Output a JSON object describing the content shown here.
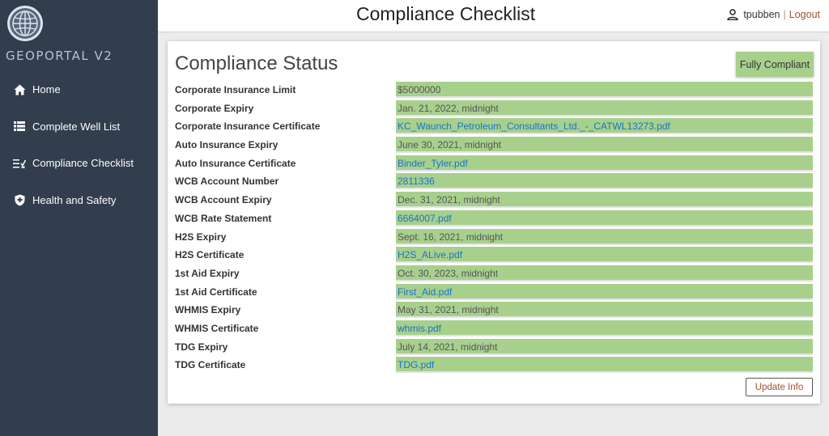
{
  "app": {
    "brand": "GEOPORTAL V2"
  },
  "sidebar": {
    "items": [
      {
        "label": "Home",
        "icon": "home-icon"
      },
      {
        "label": "Complete Well List",
        "icon": "list-icon"
      },
      {
        "label": "Compliance Checklist",
        "icon": "checklist-icon"
      },
      {
        "label": "Health and Safety",
        "icon": "shield-icon"
      }
    ]
  },
  "header": {
    "title": "Compliance Checklist",
    "username": "tpubben",
    "separator": "|",
    "logout_label": "Logout"
  },
  "card": {
    "title": "Compliance Status",
    "status": "Fully Compliant",
    "update_label": "Update Info",
    "rows": [
      {
        "label": "Corporate Insurance Limit",
        "value": "$5000000",
        "link": false
      },
      {
        "label": "Corporate Expiry",
        "value": "Jan. 21, 2022, midnight",
        "link": false
      },
      {
        "label": "Corporate Insurance Certificate",
        "value": "KC_Waunch_Petroleum_Consultants_Ltd._-_CATWL13273.pdf",
        "link": true
      },
      {
        "label": "Auto Insurance Expiry",
        "value": "June 30, 2021, midnight",
        "link": false
      },
      {
        "label": "Auto Insurance Certificate",
        "value": "Binder_Tyler.pdf",
        "link": true
      },
      {
        "label": "WCB Account Number",
        "value": "2811336",
        "link": true
      },
      {
        "label": "WCB Account Expiry",
        "value": "Dec. 31, 2021, midnight",
        "link": false
      },
      {
        "label": "WCB Rate Statement",
        "value": "6664007.pdf",
        "link": true
      },
      {
        "label": "H2S Expiry",
        "value": "Sept. 16, 2021, midnight",
        "link": false
      },
      {
        "label": "H2S Certificate",
        "value": "H2S_ALive.pdf",
        "link": true
      },
      {
        "label": "1st Aid Expiry",
        "value": "Oct. 30, 2023, midnight",
        "link": false
      },
      {
        "label": "1st Aid Certificate",
        "value": "First_Aid.pdf",
        "link": true
      },
      {
        "label": "WHMIS Expiry",
        "value": "May 31, 2021, midnight",
        "link": false
      },
      {
        "label": "WHMIS Certificate",
        "value": "whmis.pdf",
        "link": true
      },
      {
        "label": "TDG Expiry",
        "value": "July 14, 2021, midnight",
        "link": false
      },
      {
        "label": "TDG Certificate",
        "value": "TDG.pdf",
        "link": true
      }
    ]
  },
  "colors": {
    "sidebar": "#323d4d",
    "compliant": "#a8d08d",
    "link": "#1a73c8",
    "logout": "#a0522d"
  }
}
